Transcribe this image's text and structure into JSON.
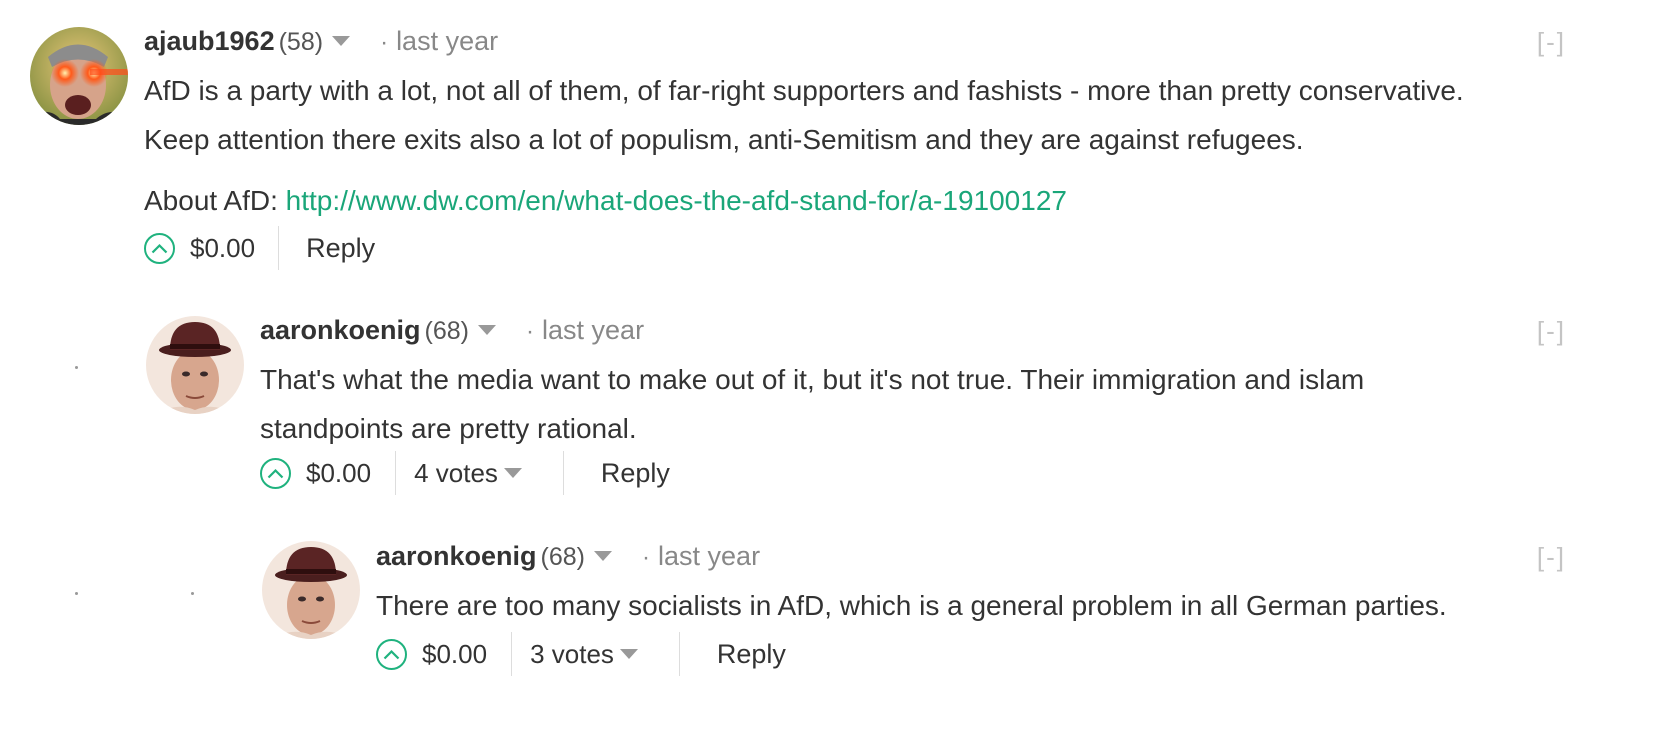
{
  "comments": [
    {
      "author": "ajaub1962",
      "reputation": "(58)",
      "separator": "·",
      "time": "last year",
      "collapse": "[-]",
      "body_lines": [
        "AfD is a party with a lot, not all of them, of far-right supporters and fashists - more than pretty conservative.",
        "Keep attention there exits also a lot of populism, anti-Semitism and they are against refugees."
      ],
      "about_label": "About AfD: ",
      "about_link": "http://www.dw.com/en/what-does-the-afd-stand-for/a-19100127",
      "payout": "$0.00",
      "reply": "Reply"
    },
    {
      "author": "aaronkoenig",
      "reputation": "(68)",
      "separator": "·",
      "time": "last year",
      "collapse": "[-]",
      "body_lines": [
        "That's what the media want to make out of it, but it's not true. Their immigration and islam",
        "standpoints are pretty rational."
      ],
      "payout": "$0.00",
      "votes": "4 votes",
      "reply": "Reply"
    },
    {
      "author": "aaronkoenig",
      "reputation": "(68)",
      "separator": "·",
      "time": "last year",
      "collapse": "[-]",
      "body_lines": [
        "There are too many socialists in AfD, which is a general problem in all German parties."
      ],
      "payout": "$0.00",
      "votes": "3 votes",
      "reply": "Reply"
    }
  ],
  "colors": {
    "accent": "#1aa679",
    "upvote": "#1fb27e",
    "muted": "#888888",
    "collapse": "#c4c4c4"
  },
  "icons": {
    "upvote": "chevron-up-circle-icon",
    "dropdown": "caret-down-icon"
  }
}
